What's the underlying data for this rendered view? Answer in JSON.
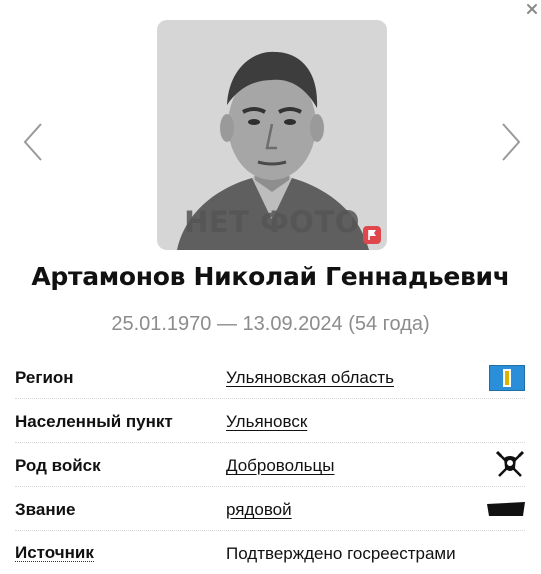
{
  "photo": {
    "placeholder_text": "НЕТ ФОТО"
  },
  "person": {
    "name": "Артамонов Николай Геннадьевич",
    "dates": "25.01.1970 — 13.09.2024 (54 года)"
  },
  "details": [
    {
      "label": "Регион",
      "value": "Ульяновская область",
      "icon": "region-flag-icon"
    },
    {
      "label": "Населенный пункт",
      "value": "Ульяновск",
      "icon": ""
    },
    {
      "label": "Род войск",
      "value": "Добровольцы",
      "icon": "volunteers-emblem-icon"
    },
    {
      "label": "Звание",
      "value": "рядовой",
      "icon": "rank-insignia-icon"
    },
    {
      "label": "Источник",
      "value": "Подтверждено госреестрами",
      "icon": ""
    }
  ],
  "colors": {
    "flag_badge": "#e0474c",
    "region_flag_blue": "#2a8fd8",
    "muted_text": "#8c8c8c"
  }
}
